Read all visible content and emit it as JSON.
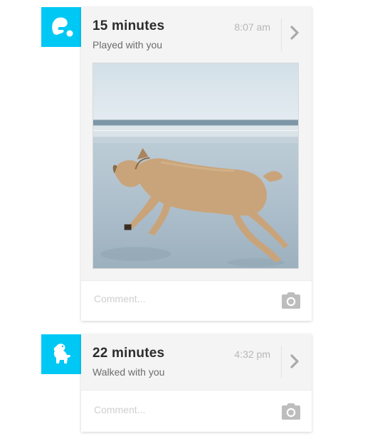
{
  "feed": {
    "items": [
      {
        "icon": "play-ball-icon",
        "title": "15 minutes",
        "subtitle": "Played with you",
        "time": "8:07 am",
        "photo": "dog-running-on-beach",
        "comment_placeholder": "Comment..."
      },
      {
        "icon": "dog-walk-icon",
        "title": "22 minutes",
        "subtitle": "Walked with you",
        "time": "4:32 pm",
        "comment_placeholder": "Comment..."
      }
    ]
  },
  "colors": {
    "accent": "#00c8f5",
    "card_bg": "#f4f4f4",
    "comment_bg": "#ffffff",
    "title": "#2c2c2c",
    "subtitle": "#6c6c6c",
    "muted": "#b7b7b7"
  }
}
